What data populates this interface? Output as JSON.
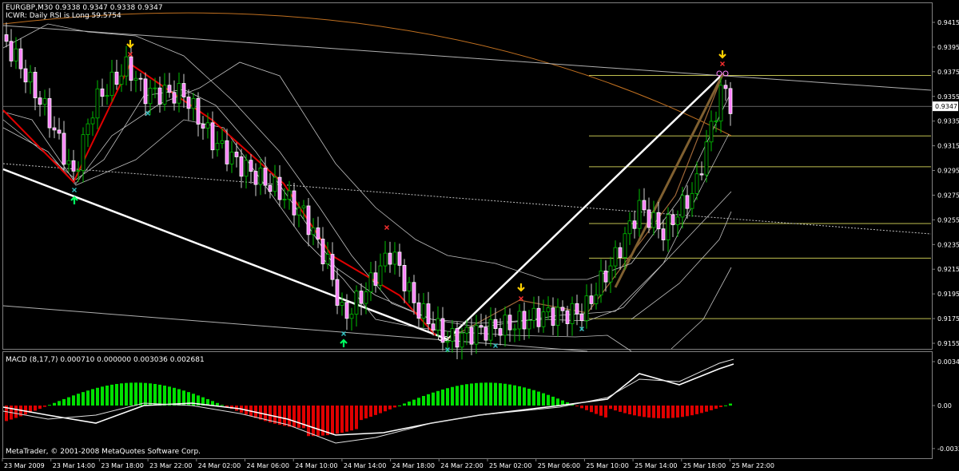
{
  "header": {
    "line1": "EURGBP,M30  0.9338 0.9347 0.9338 0.9347",
    "line2": "ICWR: Daily RSI is Long 59.5754"
  },
  "footer": {
    "copyright": "MetaTrader, © 2001-2008 MetaQuotes Software Corp."
  },
  "colors": {
    "background": "#000000",
    "bull": "#00c000",
    "bear": "#ff80ff",
    "bear_border": "#ffffff",
    "zigzag": "#e00000",
    "white_line": "#ffffff",
    "bands": "#c0c0c0",
    "orange_curve": "#c07020",
    "fib": "#c0c050",
    "macd_up": "#00e000",
    "macd_down": "#e00000",
    "arrow_up": "#00ff60",
    "arrow_down": "#ffd000",
    "x_mark": "#ff3030",
    "x_mark_low": "#30c0c0"
  },
  "chart_data": [
    {
      "type": "candlestick",
      "name": "EURGBP,M30",
      "ylim": [
        0.915,
        0.9425
      ],
      "y_ticks": [
        "0.9415",
        "0.9395",
        "0.9375",
        "0.9355",
        "0.9335",
        "0.9315",
        "0.9295",
        "0.9275",
        "0.9255",
        "0.9235",
        "0.9215",
        "0.9195",
        "0.9175",
        "0.9155"
      ],
      "current_price_label": "0.9347",
      "current_price": 0.9347,
      "x_ticks": [
        "23 Mar 2009",
        "23 Mar 14:00",
        "23 Mar 18:00",
        "23 Mar 22:00",
        "24 Mar 02:00",
        "24 Mar 06:00",
        "24 Mar 10:00",
        "24 Mar 14:00",
        "24 Mar 18:00",
        "24 Mar 22:00",
        "25 Mar 02:00",
        "25 Mar 06:00",
        "25 Mar 10:00",
        "25 Mar 14:00",
        "25 Mar 18:00",
        "25 Mar 22:00"
      ],
      "fib_levels": [
        0.9372,
        0.9323,
        0.9298,
        0.9252,
        0.9224,
        0.9175
      ],
      "grid": false
    },
    {
      "type": "bar",
      "name": "MACD",
      "label": "MACD  (8,17,7) 0.000710 0.000000 0.003036 0.002681",
      "params": "(8,17,7)",
      "ylim": [
        -0.00338,
        0.00345
      ],
      "y_ticks": [
        "0.00345",
        "0.00",
        "-0.00338"
      ],
      "grid": false
    }
  ]
}
